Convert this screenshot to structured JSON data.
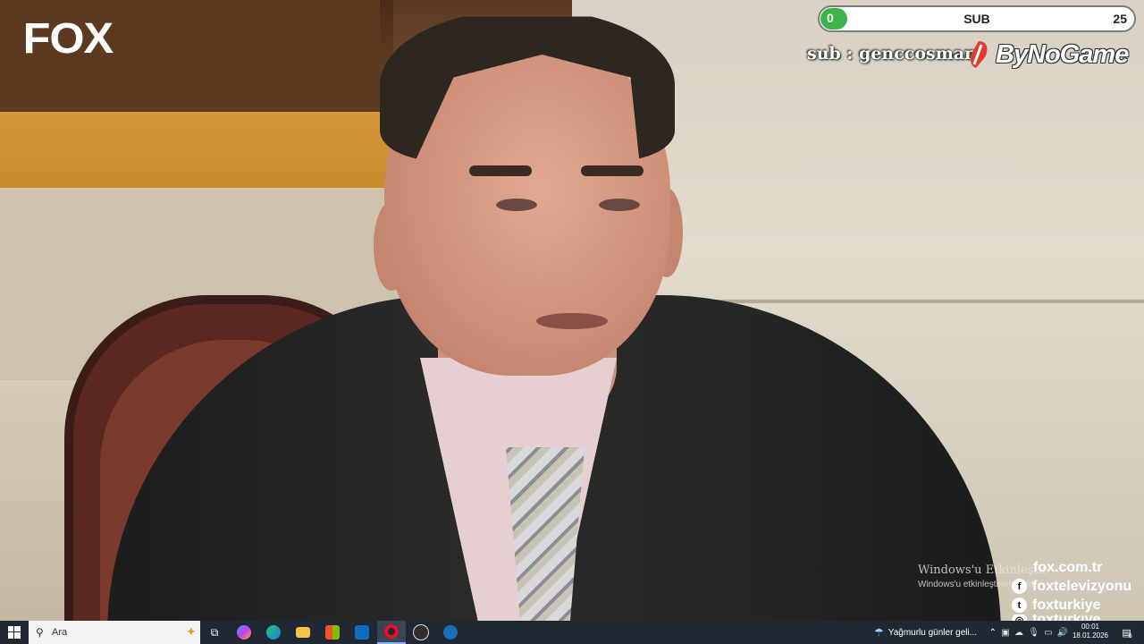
{
  "overlay": {
    "channel_logo": "FOX",
    "sub_goal": {
      "label": "SUB",
      "current": "0",
      "goal": "25",
      "progress": 0.0
    },
    "sub_text": "sub : genccosman",
    "sponsor": "ByNoGame",
    "windows_activate_title": "Windows'u Etkinleştir",
    "windows_activate_sub": "Windows'u etkinleştirmek için",
    "social": [
      {
        "icon": "web-icon",
        "text": "fox.com.tr"
      },
      {
        "icon": "facebook-icon",
        "text": "foxtelevizyonu"
      },
      {
        "icon": "twitter-icon",
        "text": "foxturkiye"
      },
      {
        "icon": "instagram-icon",
        "text": "foxturkiye"
      }
    ]
  },
  "taskbar": {
    "search_placeholder": "Ara",
    "apps": [
      "task-view-icon",
      "copilot-icon",
      "edge-icon",
      "file-explorer-icon",
      "store-icon",
      "outlook-icon",
      "opera-icon",
      "obs-icon",
      "steam-icon"
    ],
    "weather": "Yağmurlu günler geli...",
    "time": "00:01",
    "date": "18.01.2026",
    "notification_count": "6"
  },
  "colors": {
    "taskbar": "#1f2833",
    "sub_fill": "#3fb34a"
  }
}
